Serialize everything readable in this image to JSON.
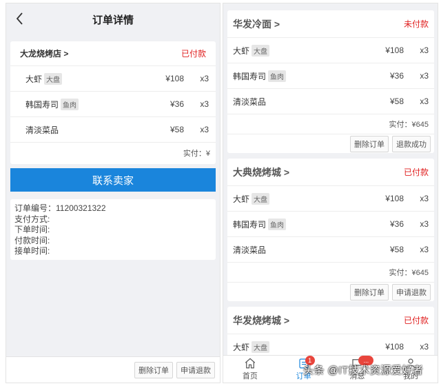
{
  "left": {
    "title": "订单详情",
    "order": {
      "shop": "大龙烧烤店 >",
      "status": "已付款",
      "items": [
        {
          "name": "大虾",
          "tag": "大盘",
          "price": "¥108",
          "qty": "x3"
        },
        {
          "name": "韩国寿司",
          "tag": "鱼肉",
          "price": "¥36",
          "qty": "x3"
        },
        {
          "name": "清淡菜品",
          "tag": "",
          "price": "¥58",
          "qty": "x3"
        }
      ],
      "paid": "实付：¥"
    },
    "contact_button": "联系卖家",
    "info": {
      "order_no": "订单编号：11200321322",
      "pay_method": "支付方式:",
      "order_time": "下单时间:",
      "pay_time": "付款时间:",
      "accept_time": "接单时间:"
    },
    "footer": {
      "delete_label": "删除订单",
      "refund_label": "申请退款"
    }
  },
  "right": {
    "orders": [
      {
        "shop": "华发冷面 >",
        "status": "未付款",
        "items": [
          {
            "name": "大虾",
            "tag": "大盘",
            "price": "¥108",
            "qty": "x3"
          },
          {
            "name": "韩国寿司",
            "tag": "鱼肉",
            "price": "¥36",
            "qty": "x3"
          },
          {
            "name": "清淡菜品",
            "tag": "",
            "price": "¥58",
            "qty": "x3"
          }
        ],
        "paid": "实付：¥645",
        "actions": [
          "删除订单",
          "退款成功"
        ]
      },
      {
        "shop": "大典烧烤城 >",
        "status": "已付款",
        "items": [
          {
            "name": "大虾",
            "tag": "大盘",
            "price": "¥108",
            "qty": "x3"
          },
          {
            "name": "韩国寿司",
            "tag": "鱼肉",
            "price": "¥36",
            "qty": "x3"
          },
          {
            "name": "清淡菜品",
            "tag": "",
            "price": "¥58",
            "qty": "x3"
          }
        ],
        "paid": "实付：¥645",
        "actions": [
          "删除订单",
          "申请退款"
        ]
      },
      {
        "shop": "华发烧烤城 >",
        "status": "已付款",
        "items": [
          {
            "name": "大虾",
            "tag": "大盘",
            "price": "¥108",
            "qty": "x3"
          }
        ]
      }
    ],
    "tabbar": {
      "tabs": [
        {
          "label": "首页",
          "icon": "home-icon"
        },
        {
          "label": "订单",
          "icon": "order-icon",
          "badge": "1"
        },
        {
          "label": "消息",
          "icon": "message-icon",
          "badge": "..."
        },
        {
          "label": "我的",
          "icon": "user-icon"
        }
      ]
    }
  },
  "watermark": "头条 @IT技术资源爱好者",
  "colors": {
    "accent": "#1a85dc",
    "status_red": "#e02020",
    "badge": "#e8453c",
    "background": "#f0f1f4"
  }
}
